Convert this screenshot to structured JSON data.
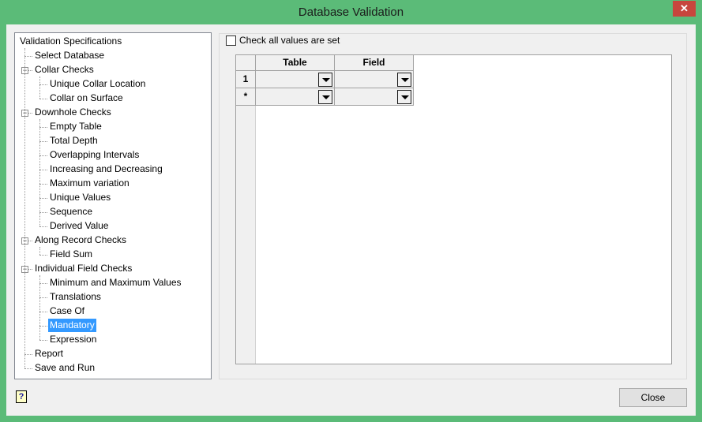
{
  "window": {
    "title": "Database Validation",
    "close_glyph": "✕"
  },
  "tree": {
    "items": [
      {
        "label": "Validation Specifications",
        "level": 0
      },
      {
        "label": "Select Database",
        "level": 1
      },
      {
        "label": "Collar Checks",
        "level": 1,
        "expanded": true
      },
      {
        "label": "Unique Collar Location",
        "level": 2
      },
      {
        "label": "Collar on Surface",
        "level": 2
      },
      {
        "label": "Downhole Checks",
        "level": 1,
        "expanded": true
      },
      {
        "label": "Empty Table",
        "level": 2
      },
      {
        "label": "Total Depth",
        "level": 2
      },
      {
        "label": "Overlapping Intervals",
        "level": 2
      },
      {
        "label": "Increasing and Decreasing",
        "level": 2
      },
      {
        "label": "Maximum variation",
        "level": 2
      },
      {
        "label": "Unique Values",
        "level": 2
      },
      {
        "label": "Sequence",
        "level": 2
      },
      {
        "label": "Derived Value",
        "level": 2
      },
      {
        "label": "Along Record Checks",
        "level": 1,
        "expanded": true
      },
      {
        "label": "Field Sum",
        "level": 2
      },
      {
        "label": "Individual Field Checks",
        "level": 1,
        "expanded": true
      },
      {
        "label": "Minimum and Maximum Values",
        "level": 2
      },
      {
        "label": "Translations",
        "level": 2
      },
      {
        "label": "Case Of",
        "level": 2
      },
      {
        "label": "Mandatory",
        "level": 2,
        "selected": true
      },
      {
        "label": "Expression",
        "level": 2
      },
      {
        "label": "Report",
        "level": 1
      },
      {
        "label": "Save and Run",
        "level": 1
      }
    ]
  },
  "main": {
    "check_all_label": "Check all values are set",
    "check_all_checked": false,
    "grid": {
      "columns": [
        "Table",
        "Field"
      ],
      "rows": [
        {
          "header": "1",
          "table": "",
          "field": ""
        },
        {
          "header": "*",
          "table": "",
          "field": ""
        }
      ]
    }
  },
  "footer": {
    "help_glyph": "?",
    "close_label": "Close"
  }
}
